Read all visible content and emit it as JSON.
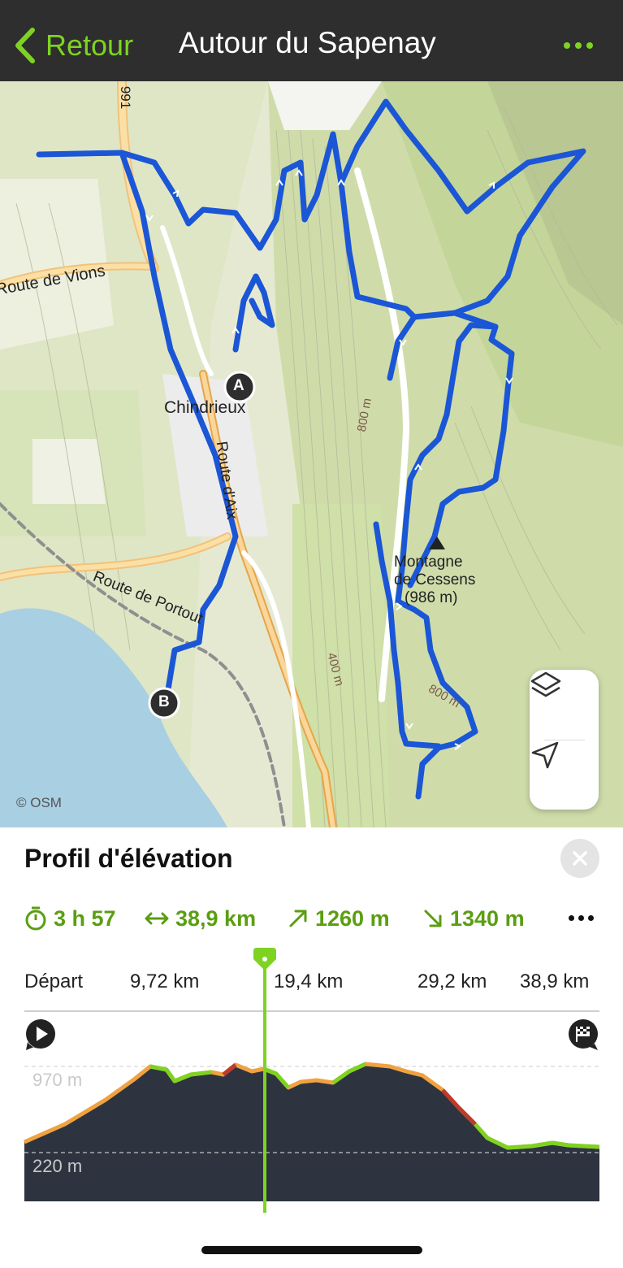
{
  "header": {
    "back_label": "Retour",
    "title": "Autour du Sapenay",
    "accent_color": "#7ed321",
    "bar_color": "#2e2e2e"
  },
  "map": {
    "labels": {
      "road_991": "991",
      "route_vions": "Route de Vions",
      "chindrieux": "Chindrieux",
      "route_aix": "Route d'Aix",
      "route_portout": "Route de Portout",
      "contour_800_a": "800 m",
      "contour_800_b": "800 m",
      "contour_400": "400 m",
      "mountain": "Montagne",
      "mountain2": "de Cessens",
      "mountain_alt": "(986 m)",
      "marker_a": "A",
      "marker_b": "B"
    },
    "attribution": "© OSM",
    "route_color": "#1a56d6",
    "controls": [
      "layers-icon",
      "locate-icon"
    ]
  },
  "panel": {
    "title": "Profil d'élévation",
    "stats": {
      "duration": "3 h 57",
      "distance": "38,9 km",
      "ascent": "1260 m",
      "descent": "1340 m"
    },
    "axis": [
      "Départ",
      "9,72 km",
      "19,4 km",
      "29,2 km",
      "38,9 km"
    ],
    "elevation": {
      "max_label": "970 m",
      "min_label": "220 m"
    },
    "cursor_fraction": 0.42
  }
}
